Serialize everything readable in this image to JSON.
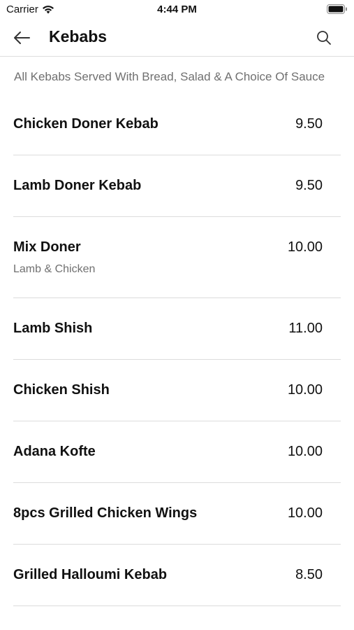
{
  "status_bar": {
    "carrier": "Carrier",
    "time": "4:44 PM"
  },
  "nav": {
    "title": "Kebabs",
    "back_icon": "arrow-left-icon",
    "search_icon": "search-icon"
  },
  "section": {
    "subtitle": "All Kebabs Served With Bread, Salad & A Choice Of Sauce"
  },
  "items": [
    {
      "name": "Chicken Doner Kebab",
      "description": "",
      "price": "9.50"
    },
    {
      "name": "Lamb Doner Kebab",
      "description": "",
      "price": "9.50"
    },
    {
      "name": "Mix Doner",
      "description": "Lamb & Chicken",
      "price": "10.00"
    },
    {
      "name": "Lamb Shish",
      "description": "",
      "price": "11.00"
    },
    {
      "name": "Chicken Shish",
      "description": "",
      "price": "10.00"
    },
    {
      "name": "Adana Kofte",
      "description": "",
      "price": "10.00"
    },
    {
      "name": "8pcs Grilled Chicken Wings",
      "description": "",
      "price": "10.00"
    },
    {
      "name": "Grilled Halloumi Kebab",
      "description": "",
      "price": "8.50"
    }
  ]
}
